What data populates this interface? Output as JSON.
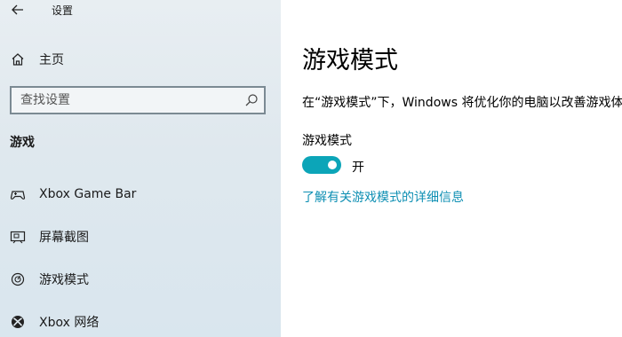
{
  "app": {
    "title": "设置"
  },
  "sidebar": {
    "home_label": "主页",
    "search": {
      "placeholder": "查找设置",
      "value": ""
    },
    "section_heading": "游戏",
    "items": [
      {
        "label": "Xbox Game Bar",
        "icon": "controller-icon"
      },
      {
        "label": "屏幕截图",
        "icon": "screen-capture-icon"
      },
      {
        "label": "游戏模式",
        "icon": "game-mode-icon"
      },
      {
        "label": "Xbox 网络",
        "icon": "xbox-icon"
      }
    ]
  },
  "main": {
    "title": "游戏模式",
    "description": "在“游戏模式”下，Windows 将优化你的电脑以改善游戏体验",
    "setting_label": "游戏模式",
    "toggle": {
      "state": "on",
      "state_label": "开"
    },
    "learn_more_link": "了解有关游戏模式的详细信息"
  },
  "colors": {
    "accent": "#0ca5b8",
    "link": "#0e8fb3",
    "sidebar_bg": "#e0e9ef"
  }
}
